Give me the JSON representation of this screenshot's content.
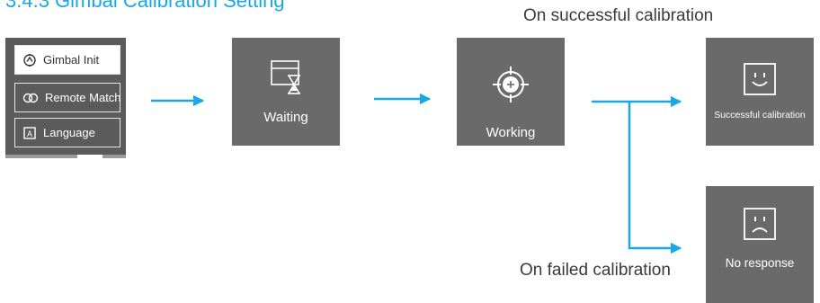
{
  "header": {
    "title": "3.4.3 Gimbal Calibration Setting"
  },
  "menu": {
    "items": [
      {
        "label": "Gimbal Init",
        "selected": true,
        "icon": "gimbal-icon"
      },
      {
        "label": "Remote Match",
        "selected": false,
        "icon": "link-icon"
      },
      {
        "label": "Language",
        "selected": false,
        "icon": "language-icon"
      }
    ]
  },
  "states": {
    "waiting": {
      "label": "Waiting",
      "icon": "hourglass-icon"
    },
    "working": {
      "label": "Working",
      "icon": "crosshair-icon"
    },
    "success": {
      "label": "Successful calibration",
      "icon": "smile-icon"
    },
    "failure": {
      "label": "No response",
      "icon": "sad-icon"
    }
  },
  "captions": {
    "success": "On successful calibration",
    "failure": "On failed calibration"
  },
  "colors": {
    "accent": "#1aa7e6",
    "tile": "#6a6a6a",
    "menu": "#5b5b5b"
  }
}
